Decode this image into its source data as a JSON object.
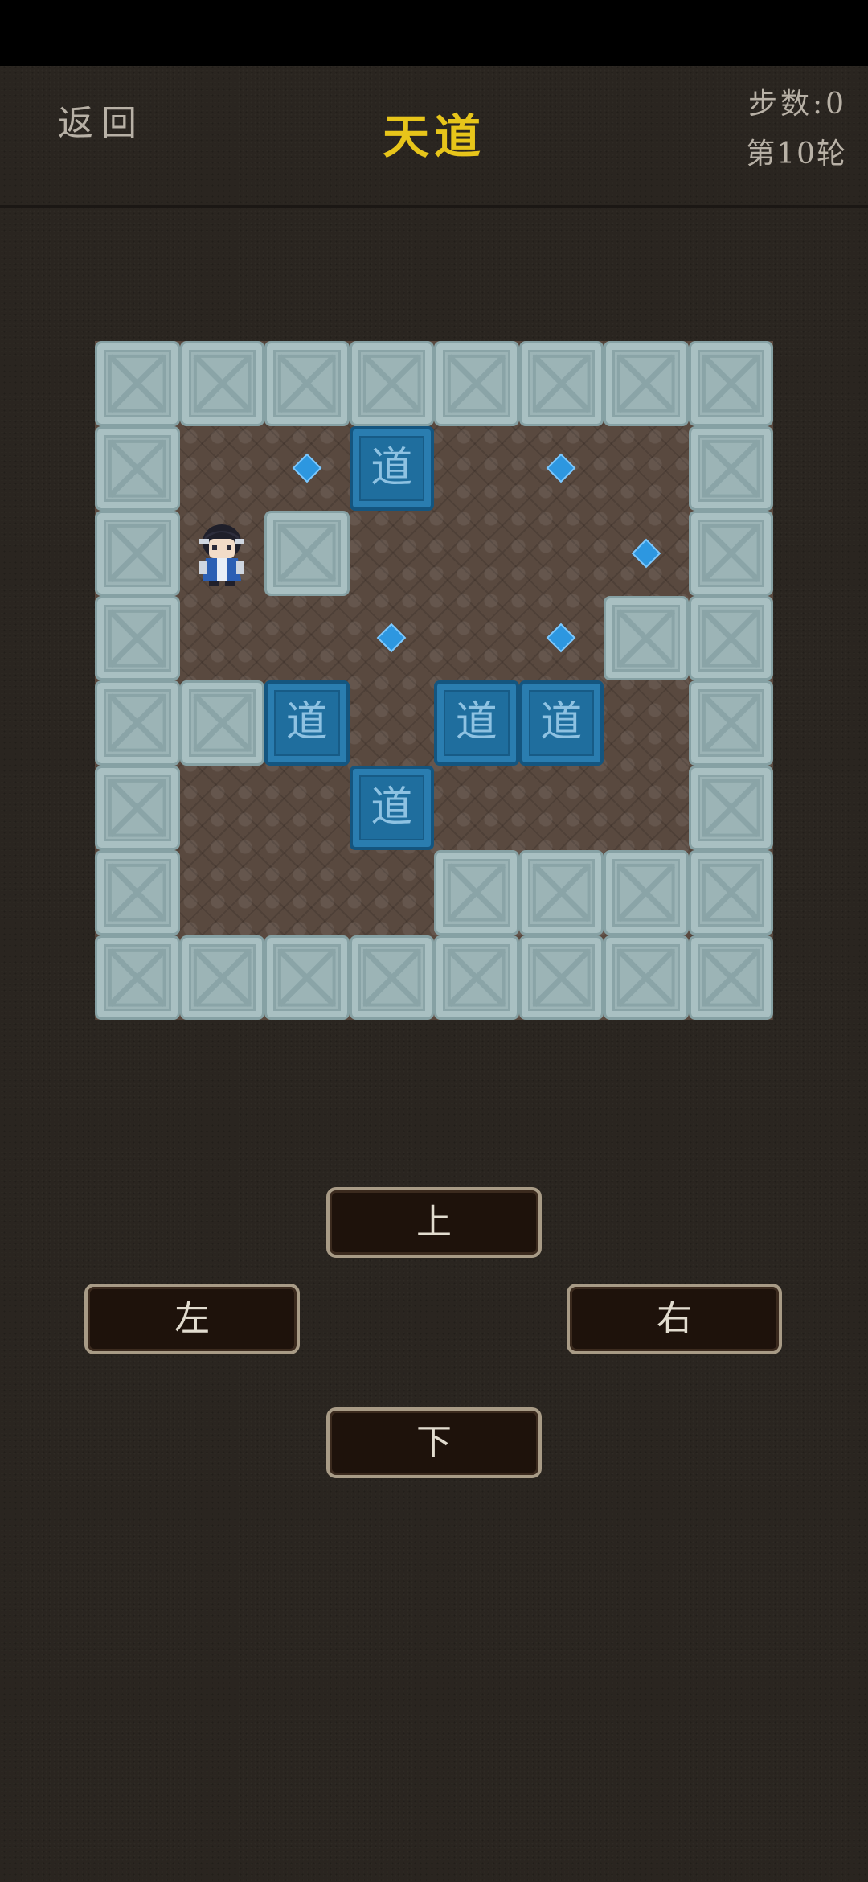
{
  "header": {
    "back_label": "返回",
    "title": "天道",
    "steps": "步数:0",
    "round": "第10轮"
  },
  "board": {
    "size": 8,
    "box_char": "道",
    "map": [
      "WWWWWWWW",
      "W.gB.g.W",
      "WPW...gW",
      "W..g.gWW",
      "WWB.BB.W",
      "W..B...W",
      "W...WWWW",
      "WWWWWWWW"
    ]
  },
  "controls": {
    "up": "上",
    "left": "左",
    "right": "右",
    "down": "下"
  },
  "colors": {
    "title": "#e7c51a",
    "wall": "#9cb4b6",
    "box": "#1f6e9e",
    "goal": "#2d97e0",
    "background": "#2a2520"
  }
}
